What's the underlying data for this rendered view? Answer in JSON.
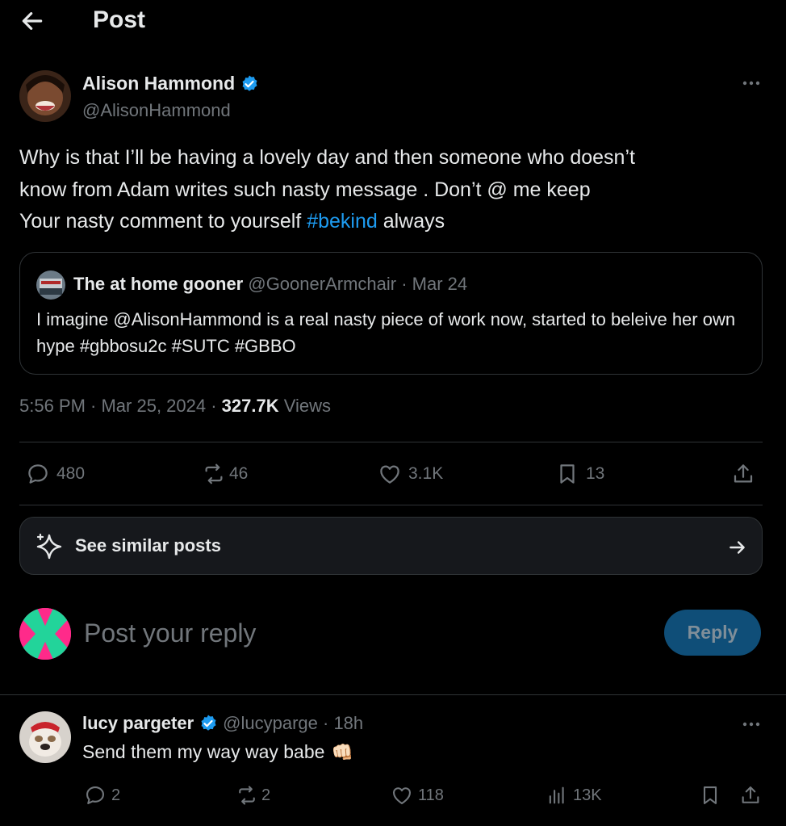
{
  "header": {
    "title": "Post"
  },
  "post": {
    "author_name": "Alison Hammond",
    "author_handle": "@AlisonHammond",
    "text_line1": "Why is that I’ll be having a lovely day and then someone who doesn’t",
    "text_line2": "know from Adam writes such nasty message . Don’t @ me keep",
    "text_line3_before": "Your nasty comment to yourself ",
    "text_hashtag": "#bekind",
    "text_line3_after": " always",
    "timestamp": "5:56 PM · Mar 25, 2024 · ",
    "views_count": "327.7K",
    "views_label": " Views"
  },
  "quote": {
    "name": "The at home gooner",
    "meta": " @GoonerArmchair · Mar 24",
    "text": "I imagine @AlisonHammond is a real nasty piece of work now, started to beleive her own hype #gbbosu2c #SUTC #GBBO"
  },
  "actions": {
    "replies": "480",
    "reposts": "46",
    "likes": "3.1K",
    "bookmarks": "13"
  },
  "similar": {
    "label": "See similar posts"
  },
  "composer": {
    "placeholder": "Post your reply",
    "button": "Reply"
  },
  "reply": {
    "name": "lucy pargeter",
    "meta": "@lucyparge · 18h",
    "text": "Send them my way way babe",
    "emoji": "👊🏻",
    "replies": "2",
    "reposts": "2",
    "likes": "118",
    "views": "13K"
  },
  "colors": {
    "background": "#000000",
    "text": "#e7e9ea",
    "muted": "#71767b",
    "accent": "#1d9bf0",
    "divider": "#2f3336",
    "reply_button": "#0f4e78"
  },
  "icons": [
    "back-arrow-icon",
    "verified-badge-icon",
    "more-icon",
    "reply-icon",
    "repost-icon",
    "like-icon",
    "bookmark-icon",
    "share-icon",
    "sparkle-icon",
    "arrow-right-icon",
    "views-icon"
  ]
}
